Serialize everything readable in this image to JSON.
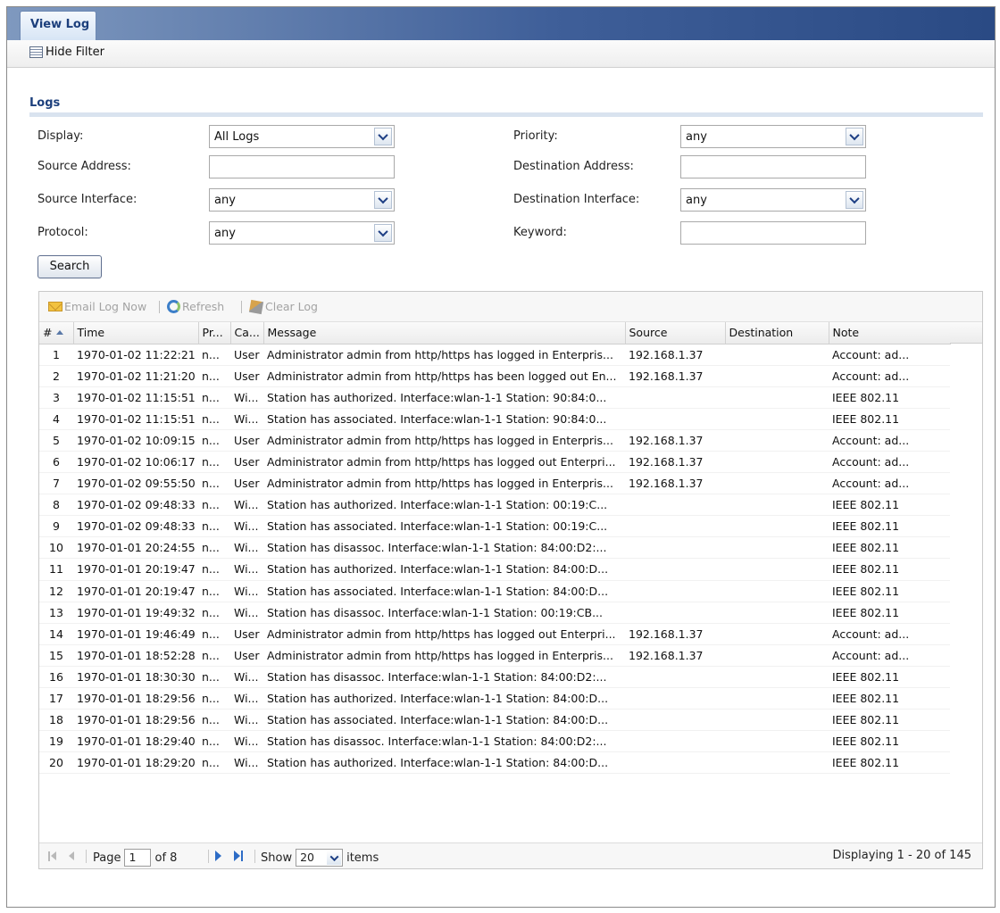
{
  "tab": {
    "label": "View Log"
  },
  "toolbar": {
    "hide_filter_label": "Hide Filter"
  },
  "section": {
    "title": "Logs"
  },
  "filters": {
    "display": {
      "label": "Display:",
      "value": "All Logs"
    },
    "priority": {
      "label": "Priority:",
      "value": "any"
    },
    "source_address": {
      "label": "Source Address:",
      "value": ""
    },
    "destination_address": {
      "label": "Destination Address:",
      "value": ""
    },
    "source_interface": {
      "label": "Source Interface:",
      "value": "any"
    },
    "destination_interface": {
      "label": "Destination Interface:",
      "value": "any"
    },
    "protocol": {
      "label": "Protocol:",
      "value": "any"
    },
    "keyword": {
      "label": "Keyword:",
      "value": ""
    },
    "search_label": "Search"
  },
  "grid_toolbar": {
    "email_label": "Email Log Now",
    "refresh_label": "Refresh",
    "clear_label": "Clear Log"
  },
  "columns": [
    "#",
    "Time",
    "Pr...",
    "Ca...",
    "Message",
    "Source",
    "Destination",
    "Note"
  ],
  "rows": [
    [
      "1",
      "1970-01-02 11:22:21",
      "n...",
      "User",
      "Administrator admin from http/https has logged in Enterpris...",
      "192.168.1.37",
      "",
      "Account: ad..."
    ],
    [
      "2",
      "1970-01-02 11:21:20",
      "n...",
      "User",
      "Administrator admin from http/https has been logged out En...",
      "192.168.1.37",
      "",
      "Account: ad..."
    ],
    [
      "3",
      "1970-01-02 11:15:51",
      "n...",
      "Wi...",
      "Station has authorized. Interface:wlan-1-1 Station: 90:84:0...",
      "",
      "",
      "IEEE 802.11"
    ],
    [
      "4",
      "1970-01-02 11:15:51",
      "n...",
      "Wi...",
      "Station has associated. Interface:wlan-1-1 Station: 90:84:0...",
      "",
      "",
      "IEEE 802.11"
    ],
    [
      "5",
      "1970-01-02 10:09:15",
      "n...",
      "User",
      "Administrator admin from http/https has logged in Enterpris...",
      "192.168.1.37",
      "",
      "Account: ad..."
    ],
    [
      "6",
      "1970-01-02 10:06:17",
      "n...",
      "User",
      "Administrator admin from http/https has logged out Enterpri...",
      "192.168.1.37",
      "",
      "Account: ad..."
    ],
    [
      "7",
      "1970-01-02 09:55:50",
      "n...",
      "User",
      "Administrator admin from http/https has logged in Enterpris...",
      "192.168.1.37",
      "",
      "Account: ad..."
    ],
    [
      "8",
      "1970-01-02 09:48:33",
      "n...",
      "Wi...",
      "Station has authorized. Interface:wlan-1-1 Station: 00:19:C...",
      "",
      "",
      "IEEE 802.11"
    ],
    [
      "9",
      "1970-01-02 09:48:33",
      "n...",
      "Wi...",
      "Station has associated. Interface:wlan-1-1 Station: 00:19:C...",
      "",
      "",
      "IEEE 802.11"
    ],
    [
      "10",
      "1970-01-01 20:24:55",
      "n...",
      "Wi...",
      "Station has disassoc. Interface:wlan-1-1 Station: 84:00:D2:...",
      "",
      "",
      "IEEE 802.11"
    ],
    [
      "11",
      "1970-01-01 20:19:47",
      "n...",
      "Wi...",
      "Station has authorized. Interface:wlan-1-1 Station: 84:00:D...",
      "",
      "",
      "IEEE 802.11"
    ],
    [
      "12",
      "1970-01-01 20:19:47",
      "n...",
      "Wi...",
      "Station has associated. Interface:wlan-1-1 Station: 84:00:D...",
      "",
      "",
      "IEEE 802.11"
    ],
    [
      "13",
      "1970-01-01 19:49:32",
      "n...",
      "Wi...",
      "Station has disassoc. Interface:wlan-1-1 Station: 00:19:CB...",
      "",
      "",
      "IEEE 802.11"
    ],
    [
      "14",
      "1970-01-01 19:46:49",
      "n...",
      "User",
      "Administrator admin from http/https has logged out Enterpri...",
      "192.168.1.37",
      "",
      "Account: ad..."
    ],
    [
      "15",
      "1970-01-01 18:52:28",
      "n...",
      "User",
      "Administrator admin from http/https has logged in Enterpris...",
      "192.168.1.37",
      "",
      "Account: ad..."
    ],
    [
      "16",
      "1970-01-01 18:30:30",
      "n...",
      "Wi...",
      "Station has disassoc. Interface:wlan-1-1 Station: 84:00:D2:...",
      "",
      "",
      "IEEE 802.11"
    ],
    [
      "17",
      "1970-01-01 18:29:56",
      "n...",
      "Wi...",
      "Station has authorized. Interface:wlan-1-1 Station: 84:00:D...",
      "",
      "",
      "IEEE 802.11"
    ],
    [
      "18",
      "1970-01-01 18:29:56",
      "n...",
      "Wi...",
      "Station has associated. Interface:wlan-1-1 Station: 84:00:D...",
      "",
      "",
      "IEEE 802.11"
    ],
    [
      "19",
      "1970-01-01 18:29:40",
      "n...",
      "Wi...",
      "Station has disassoc. Interface:wlan-1-1 Station: 84:00:D2:...",
      "",
      "",
      "IEEE 802.11"
    ],
    [
      "20",
      "1970-01-01 18:29:20",
      "n...",
      "Wi...",
      "Station has authorized. Interface:wlan-1-1 Station: 84:00:D...",
      "",
      "",
      "IEEE 802.11"
    ]
  ],
  "pager": {
    "page_label": "Page",
    "page_value": "1",
    "of_label": "of 8",
    "show_label": "Show",
    "show_value": "20",
    "items_label": "items",
    "displaying": "Displaying 1 - 20 of 145"
  }
}
